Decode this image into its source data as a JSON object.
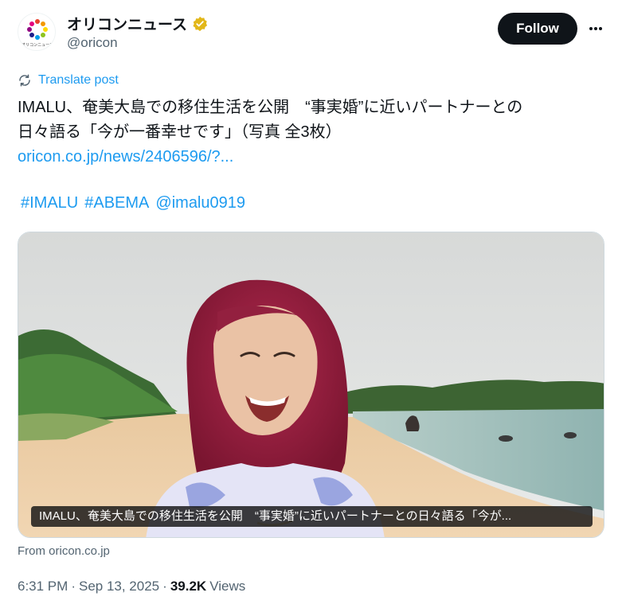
{
  "author": {
    "display_name": "オリコンニュース",
    "handle": "@oricon",
    "avatar_text": "オリコンニュース",
    "verified_color": "#e2b719"
  },
  "actions": {
    "follow_label": "Follow"
  },
  "translate": {
    "label": "Translate post"
  },
  "tweet": {
    "line1": "IMALU、奄美大島での移住生活を公開　“事実婚”に近いパートナーとの",
    "line2": "日々語る「今が一番幸せです」（写真 全3枚）",
    "link": "oricon.co.jp/news/2406596/?...",
    "hashtags": [
      "#IMALU",
      "#ABEMA",
      "@imalu0919"
    ]
  },
  "media": {
    "caption": "IMALU、奄美大島での移住生活を公開　“事実婚”に近いパートナーとの日々語る「今が..."
  },
  "source": {
    "label": "From oricon.co.jp"
  },
  "meta": {
    "time": "6:31 PM",
    "separator": "·",
    "date": "Sep 13, 2025",
    "views_count": "39.2K",
    "views_label": "Views"
  },
  "colors": {
    "link": "#1d9bf0",
    "text": "#0f1419",
    "secondary": "#536471"
  }
}
